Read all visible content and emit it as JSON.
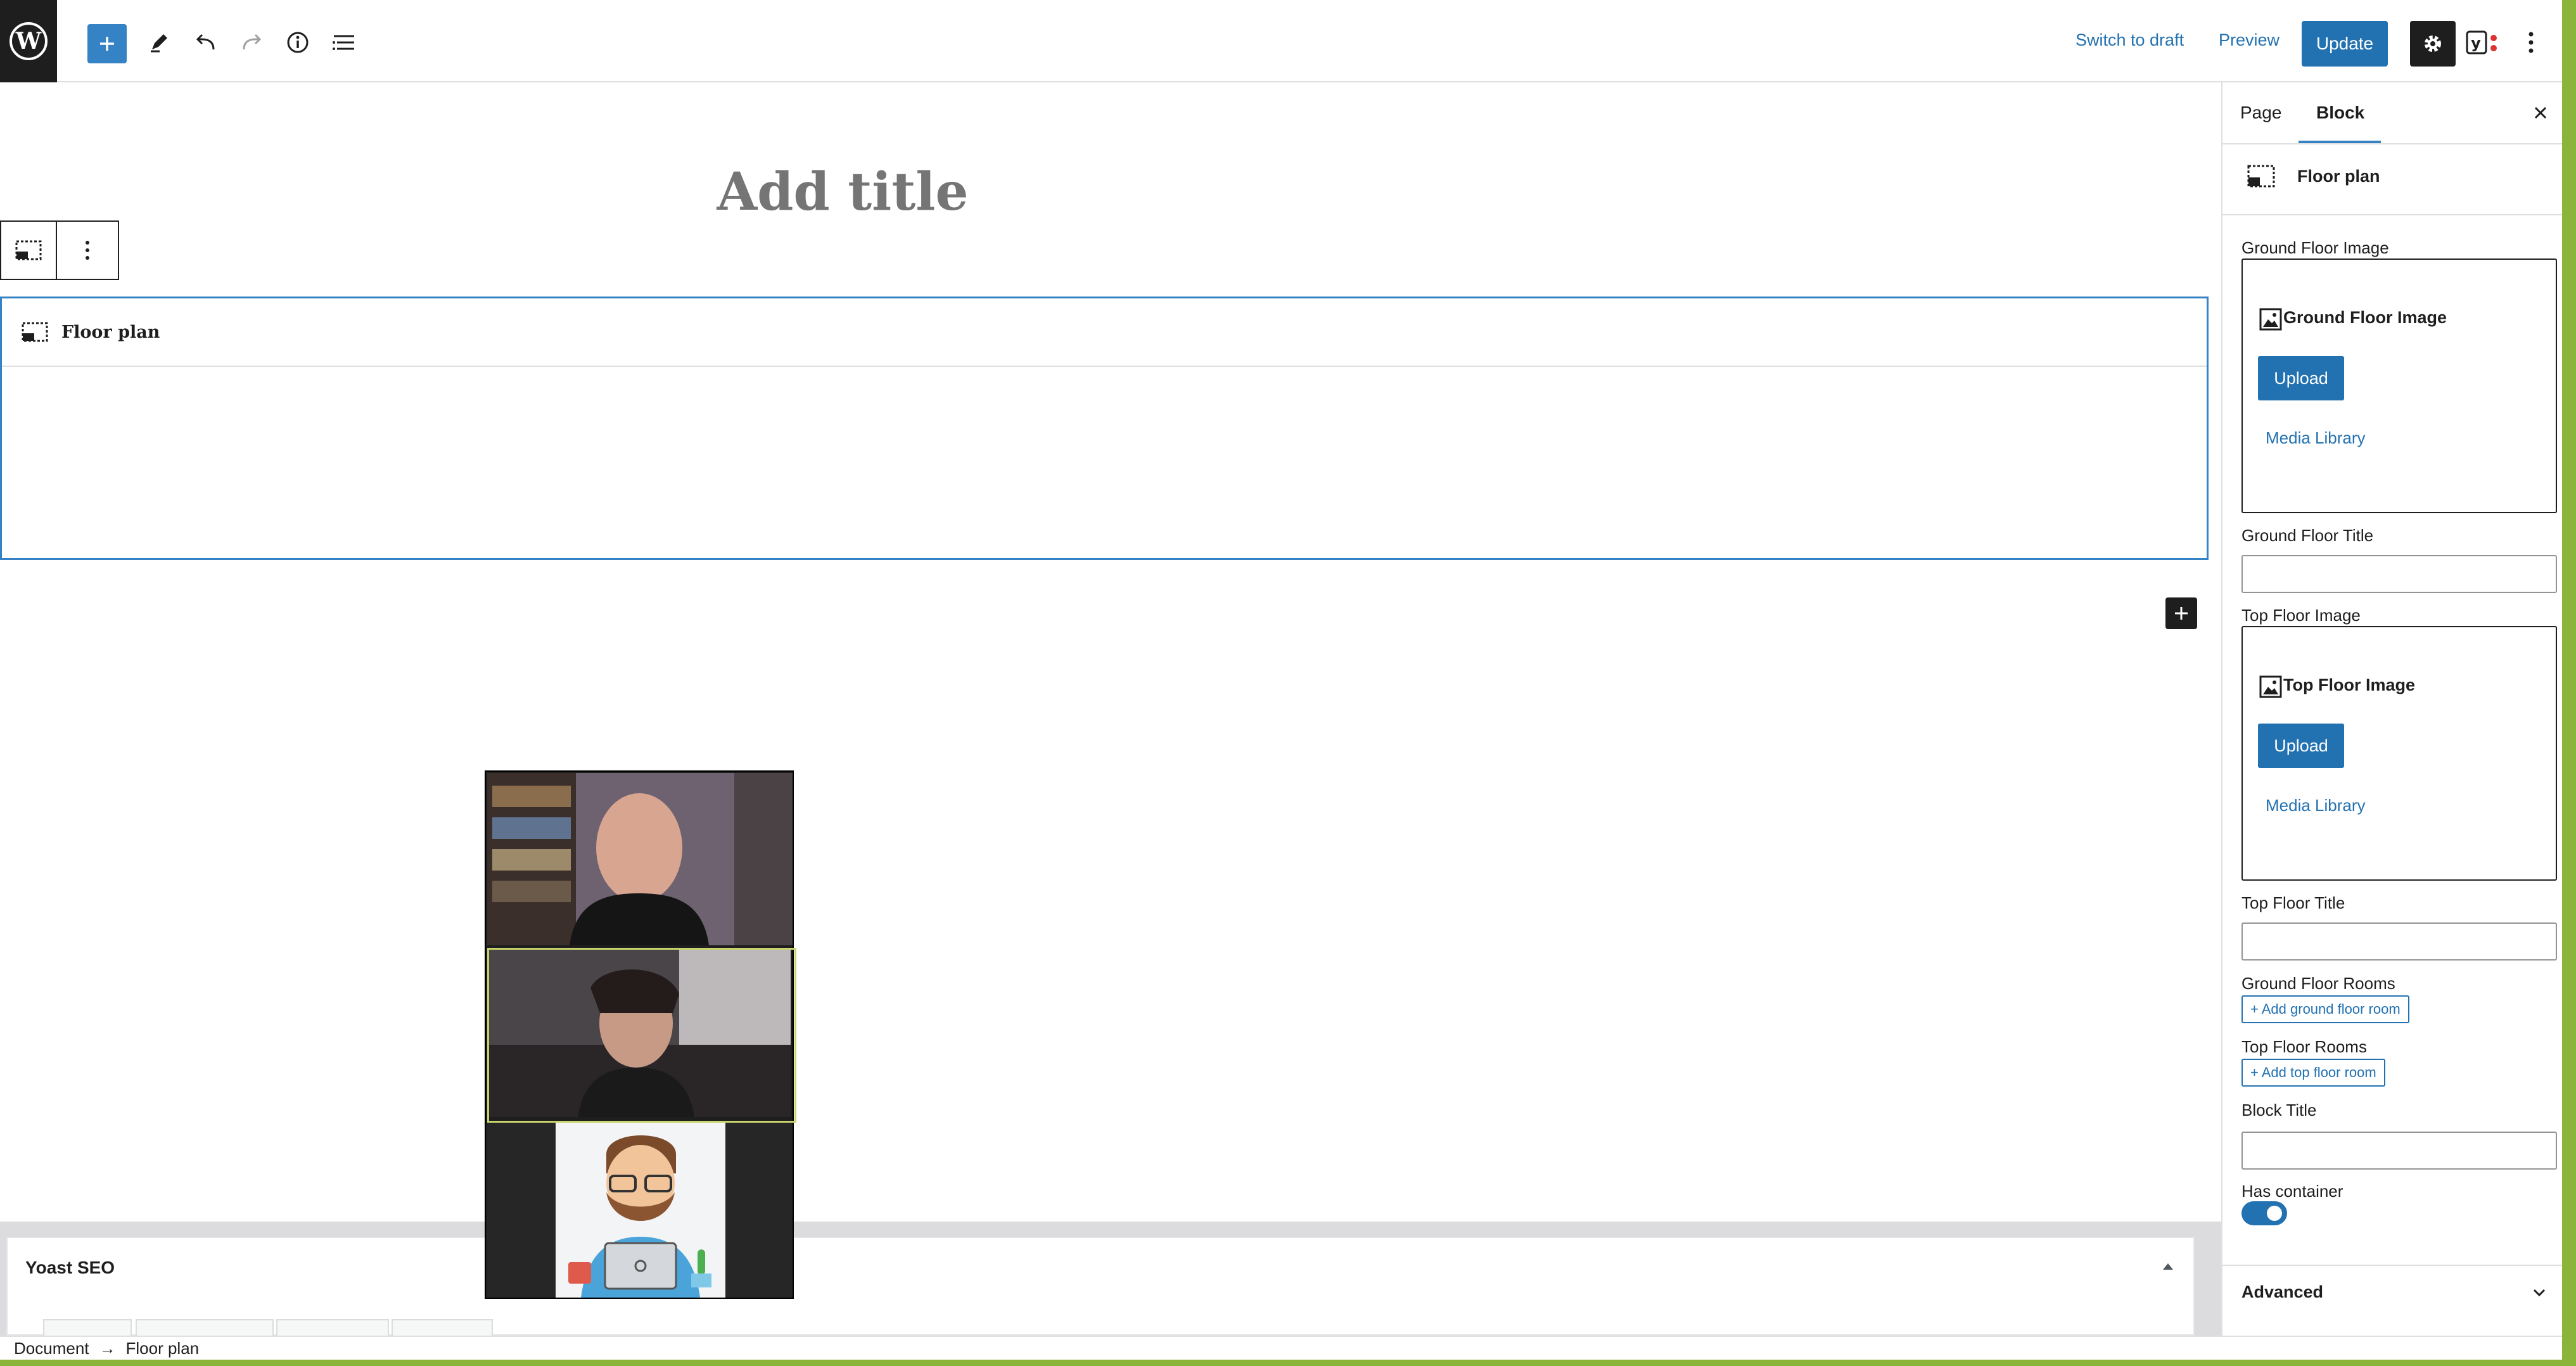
{
  "topbar": {
    "switch_to_draft": "Switch to draft",
    "preview": "Preview",
    "update": "Update"
  },
  "editor": {
    "title_placeholder": "Add title",
    "block_name": "Floor plan"
  },
  "sidebar": {
    "tabs": [
      "Page",
      "Block"
    ],
    "active_tab": "Block",
    "block_card_title": "Floor plan",
    "ground_floor_image_label": "Ground Floor Image",
    "ground_floor_image_title": "Ground Floor Image",
    "upload_label": "Upload",
    "media_library_label": "Media Library",
    "ground_floor_title_label": "Ground Floor Title",
    "top_floor_image_label": "Top Floor Image",
    "top_floor_image_title": "Top Floor Image",
    "top_floor_title_label": "Top Floor Title",
    "ground_floor_rooms_label": "Ground Floor Rooms",
    "add_ground_floor_room": "+ Add ground floor room",
    "top_floor_rooms_label": "Top Floor Rooms",
    "add_top_floor_room": "+ Add top floor room",
    "block_title_label": "Block Title",
    "has_container_label": "Has container",
    "has_container_on": true,
    "advanced_label": "Advanced"
  },
  "metabox": {
    "yoast_title": "Yoast SEO"
  },
  "footer": {
    "crumb_root": "Document",
    "crumb_arrow": "→",
    "crumb_current": "Floor plan"
  },
  "colors": {
    "accent": "#2271b1",
    "selection": "#3582c4",
    "frame_green": "#8ab53a",
    "dark": "#1e1e1e"
  }
}
